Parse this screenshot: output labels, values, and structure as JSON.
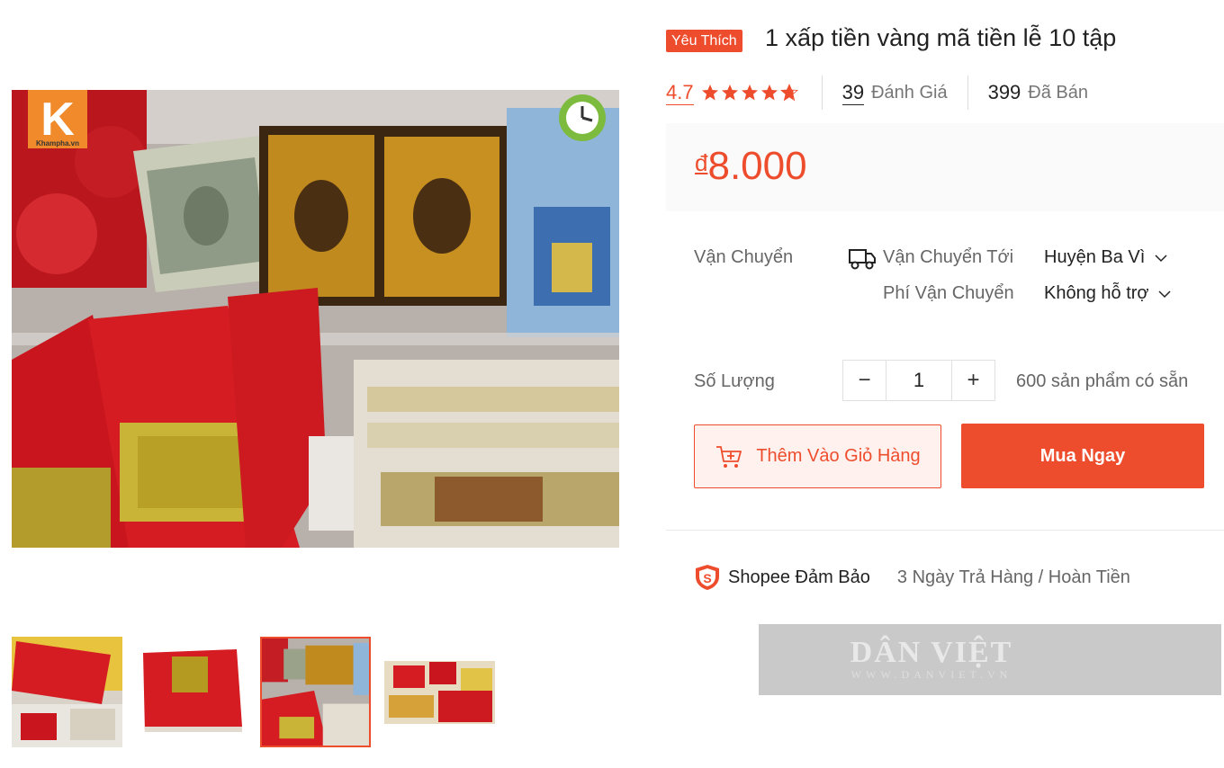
{
  "product": {
    "badge": "Yêu Thích",
    "title": "1 xấp tiền vàng mã tiền lễ 10 tập",
    "rating": "4.7",
    "rating_stars": 4.7,
    "reviews_count": "39",
    "reviews_label": "Đánh Giá",
    "sold_count": "399",
    "sold_label": "Đã Bán",
    "currency": "đ",
    "price": "8.000"
  },
  "shipping": {
    "label": "Vận Chuyển",
    "to_label": "Vận Chuyển Tới",
    "to_value": "Huyện Ba Vì",
    "fee_label": "Phí Vận Chuyển",
    "fee_value": "Không hỗ trợ"
  },
  "quantity": {
    "label": "Số Lượng",
    "minus": "−",
    "value": "1",
    "plus": "+",
    "stock": "600 sản phẩm có sẵn"
  },
  "actions": {
    "add_to_cart": "Thêm Vào Giỏ Hàng",
    "buy_now": "Mua Ngay"
  },
  "guarantee": {
    "title": "Shopee Đảm Bảo",
    "detail": "3 Ngày Trả Hàng / Hoàn Tiền"
  },
  "image": {
    "logo_letter": "K",
    "logo_text": "Khampha.vn"
  },
  "watermark": {
    "brand": "DÂN VIỆT",
    "url": "WWW.DANVIET.VN"
  },
  "colors": {
    "accent": "#ee4d2d",
    "price_bg": "#fafafa",
    "cart_bg": "#fff2ee"
  },
  "icons": [
    "star-icon",
    "truck-icon",
    "chevron-down-icon",
    "cart-plus-icon",
    "shield-icon",
    "clock-icon"
  ]
}
